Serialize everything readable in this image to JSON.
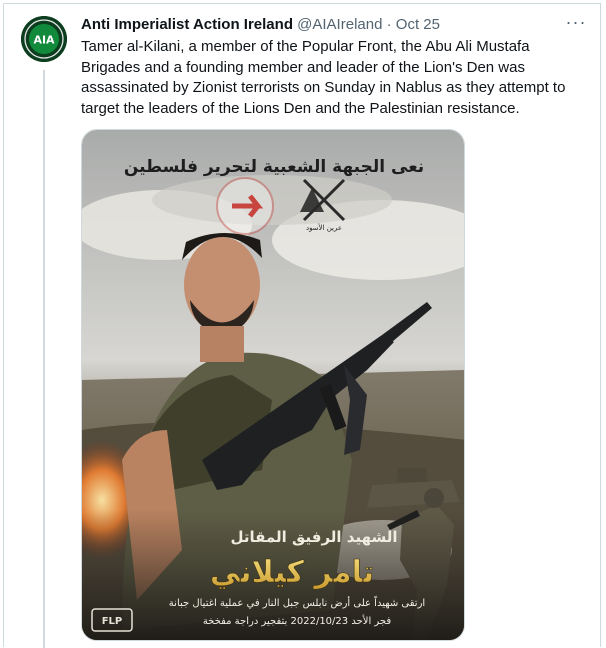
{
  "tweet": {
    "author": {
      "display_name": "Anti Imperialist Action Ireland",
      "handle": "@AIAIreland",
      "avatar_text": "AIA"
    },
    "separator": "·",
    "date": "Oct 25",
    "more_icon": "more-horizontal-icon",
    "text": "Tamer al-Kilani, a member of the Popular Front, the Abu Ali Mustafa Brigades and a founding member and leader of the Lion's Den was assassinated by Zionist terrorists on Sunday in Nablus as they attempt to target the leaders of the Lions Den and the Palestinian resistance.",
    "media": {
      "top_banner": "نعى الجبهة الشعبية لتحرير فلسطين",
      "lions_den_emblem_text": "عرين الأسود",
      "title_line": "الشهيد الرفيق المقاتل",
      "name_line": "تامر كيلاني",
      "caption_line1": "ارتقى شهيداً على أرض نابلس جبل النار في عملية اغتيال جبانة",
      "caption_line2": "فجر الأحد 2022/10/23 بتفجير دراجة مفخخة",
      "logo_text": "FLP"
    }
  }
}
